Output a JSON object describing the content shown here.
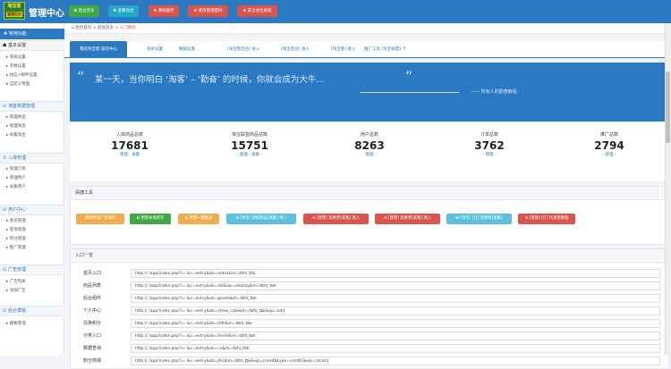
{
  "header": {
    "logo_line1": "淘宝客",
    "logo_line2": "管理后台",
    "title": "管理中心",
    "buttons": [
      {
        "label": "✿ 后台首页",
        "color": "#3fa845"
      },
      {
        "label": "✿ 查看前台",
        "color": "#22a6c9"
      },
      {
        "label": "⊗ 清除缓存",
        "color": "#d9534f"
      },
      {
        "label": "⊗ 修改管理密码",
        "color": "#d9534f"
      },
      {
        "label": "⊗ 安全退出系统",
        "color": "#d9534f"
      }
    ]
  },
  "sidebar": {
    "header": "✚ 常用功能",
    "groups": [
      {
        "label": "☗ 基本设置",
        "dark": true,
        "items": [
          "▸ 系统设置",
          "▸ 参数设置",
          "▸ 短信+邮件设置",
          "▸ 自定义界面"
        ]
      },
      {
        "label": "☑ 淘客数据管理",
        "dark": false,
        "items": [
          "▸ 管理商品",
          "▸ 管理淘宝",
          "▸ 采集淘宝"
        ]
      },
      {
        "label": "☑ 入库管理",
        "dark": false,
        "items": [
          "▸ 管理订单",
          "▸ 管理用户",
          "▸ 采集用户"
        ]
      },
      {
        "label": "☑ 用户中心",
        "dark": false,
        "items": [
          "▸ 会员管理",
          "▸ 提现管理",
          "▸ 积分管理",
          "▸ 推广管理"
        ]
      },
      {
        "label": "☑ 广告管理",
        "dark": false,
        "items": [
          "▸ 广告列表",
          "▸ 添加广告"
        ]
      },
      {
        "label": "☑ 后台模板",
        "dark": false,
        "items": [
          "▸ 模板管理"
        ]
      }
    ]
  },
  "breadcrumb": {
    "home": "⌂ 后台首页",
    "sep1": " > ",
    "middle": "后台首页",
    "sep2": " > ",
    "current": "入门教程"
  },
  "tabs": [
    {
      "label": "我的淘宝客 操作中心",
      "active": true
    },
    {
      "label": "系统设置",
      "active": false
    },
    {
      "label": "数据设置",
      "active": false
    },
    {
      "label": "[淘宝客后台] 进入",
      "active": false
    },
    {
      "label": "[淘宝后台] 进入",
      "active": false
    },
    {
      "label": "[淘宝客] 进入",
      "active": false
    },
    {
      "label": "推广工具 [淘宝联盟] 下",
      "active": false
    }
  ],
  "quote": {
    "open_mark": "“",
    "text": "某一天，当你明白 ‘淘客’ – ‘勤奋’ 的时候，你就会成为大牛...",
    "close_mark": "”",
    "author": "—— 所有人的勤奋教程"
  },
  "stats": [
    {
      "label": "入库商品总数",
      "value": "17681",
      "link": "- 管理 · 采集 -"
    },
    {
      "label": "淘宝联盟商品总数",
      "value": "15751",
      "link": "- 管理 · 采集 -"
    },
    {
      "label": "用户总数",
      "value": "8263",
      "link": "- 管理 -"
    },
    {
      "label": "订单总数",
      "value": "3762",
      "link": "- 管理 -"
    },
    {
      "label": "推广总数",
      "value": "2794",
      "link": "- 管理 -"
    }
  ],
  "tools": {
    "title": "快捷工具",
    "buttons": [
      {
        "label": "清除所有广告缓存",
        "color": "#f0ad4e"
      },
      {
        "label": "✿ 更新本地库存",
        "color": "#3fa845"
      },
      {
        "label": "✿ 更新一键推送",
        "color": "#f0ad4e"
      },
      {
        "label": "✿ [淘宝] 获取商品[采集] 进入",
        "color": "#5bc0de"
      },
      {
        "label": "⊗ [管理] 优惠券[采集] 进入",
        "color": "#d9534f"
      },
      {
        "label": "⊗ [管理] 优惠券[采集] 进入",
        "color": "#d9534f"
      },
      {
        "label": "✿ [淘宝] [订] 优惠券[采集]",
        "color": "#5bc0de"
      },
      {
        "label": "⊗ [管理] [订] 优惠券数据",
        "color": "#d9534f"
      }
    ]
  },
  "entries": {
    "title": "入口一览",
    "rows": [
      {
        "label": "首页入口",
        "value": "http://      /app/index.php?i=  &c=entry&do=index&m=tbhl_tbk"
      },
      {
        "label": "商品列表",
        "value": "http://      /app/index.php?i=  &c=entry&do=list&op=display&m=tbhl_tbk"
      },
      {
        "label": "后台组件",
        "value": "http://      /app/index.php?i=  &c=entry&do=goods&m=tbhl_tbk"
      },
      {
        "label": "个人中心",
        "value": "http://      /app/index.php?i=  &c=entry&do=show_cate&m=tbhl_tbk&op=add"
      },
      {
        "label": "兑换积分",
        "value": "http://      /app/index.php?i=  &c=entry&do=jfdh&m=tbhl_tbk"
      },
      {
        "label": "分类入口",
        "value": "http://      /app/index.php?i=  &c=entry&do=fenlei&m=tbhl_tbk"
      },
      {
        "label": "数据查询",
        "value": "http://      /app/index.php?i=  &c=entry&do=cx&m=tbhl_tbk"
      },
      {
        "label": "积分商城",
        "value": "http://      /app/index.php?i=  &c=entry&do=jfsc&m=tbhl_tbk&op=credit&type=credit1&op=record"
      }
    ]
  }
}
